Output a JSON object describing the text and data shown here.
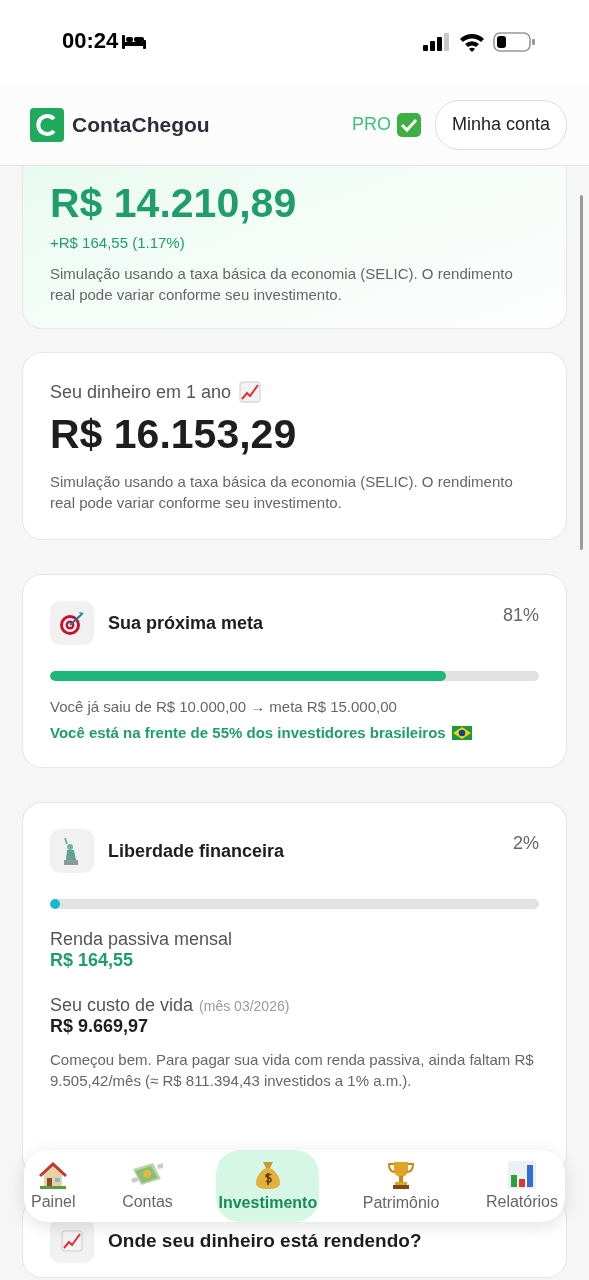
{
  "status_bar": {
    "time": "00:24"
  },
  "header": {
    "brand": "ContaChegou",
    "plan": "PRO",
    "account_button": "Minha conta"
  },
  "cards": [
    {
      "kind": "balance",
      "amount": "R$ 14.210,89",
      "change": "+R$ 164,55 (1.17%)",
      "note": "Simulação usando a taxa básica da economia (SELIC). O rendimento real pode variar conforme seu investimento."
    },
    {
      "kind": "projection",
      "title": "Seu dinheiro em 1 ano",
      "amount": "R$ 16.153,29",
      "note": "Simulação usando a taxa básica da economia (SELIC). O rendimento real pode variar conforme seu investimento."
    },
    {
      "kind": "goal",
      "title": "Sua próxima meta",
      "percent": "81%",
      "level": 0.81,
      "detail": "Você já saiu de R$ 10.000,00 → meta R$ 15.000,00",
      "highlight": "Você está na frente de 55% dos investidores brasileiros"
    },
    {
      "kind": "freedom",
      "title": "Liberdade financeira",
      "percent": "2%",
      "level": 0.02,
      "income_label": "Renda passiva mensal",
      "income": "R$ 164,55",
      "cost_label": "Seu custo de vida",
      "cost_period": "(mês 03/2026)",
      "cost": "R$ 9.669,97",
      "note": "Começou bem. Para pagar sua vida com renda passiva, ainda faltam R$ 9.505,42/mês (≈ R$ 811.394,43 investidos a 1% a.m.)."
    },
    {
      "kind": "allocation",
      "title": "Onde seu dinheiro está rendendo?"
    }
  ],
  "nav": [
    {
      "kind": "home",
      "label": "Painel",
      "selected": false
    },
    {
      "kind": "bills",
      "label": "Contas",
      "selected": false
    },
    {
      "kind": "investments",
      "label": "Investimento",
      "selected": true
    },
    {
      "kind": "assets",
      "label": "Patrimônio",
      "selected": false
    },
    {
      "kind": "reports",
      "label": "Relatórios",
      "selected": false
    }
  ]
}
